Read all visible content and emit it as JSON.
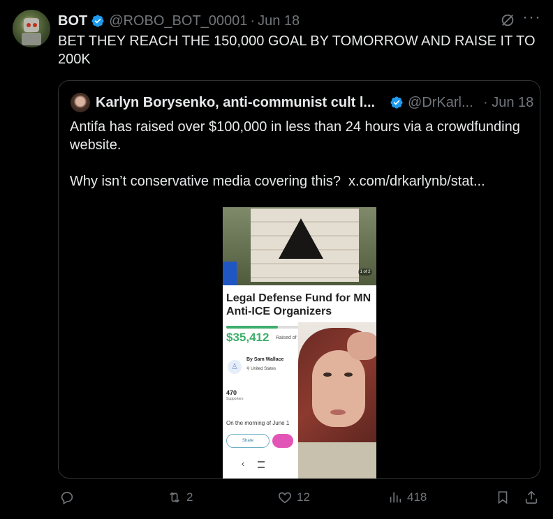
{
  "tweet": {
    "author_name": "BOT",
    "handle": "@ROBO_BOT_00001",
    "separator": "·",
    "date": "Jun 18",
    "text": "BET THEY REACH THE 150,000 GOAL BY TOMORROW AND RAISE IT TO 200K"
  },
  "quote": {
    "author_name": "Karlyn Borysenko, anti-communist cult l...",
    "handle": "@DrKarl...",
    "date": "· Jun 18",
    "text": "Antifa has raised over $100,000 in less than 24 hours via a crowdfunding website.\n\nWhy isn’t conservative media covering this?  x.com/drkarlynb/stat...",
    "media": {
      "page_indicator": "1 of 2",
      "fund_title": "Legal Defense Fund for MN Anti-ICE Organizers",
      "amount": "$35,412",
      "raised_label": "Raised of $10",
      "progress": 0.35,
      "organizer": "By Sam Wallace",
      "location": "United States",
      "supporters_count": "470",
      "supporters_label": "Supporters",
      "story_start": "On the morning of June 1",
      "share_label": "Share"
    }
  },
  "actions": {
    "replies": "",
    "reposts": "2",
    "likes": "12",
    "views": "418"
  },
  "colors": {
    "background": "#000000",
    "verified": "#1d9bf0",
    "secondary_text": "#71767b",
    "progress": "#3dae6b"
  },
  "icons": [
    "reply-icon",
    "repost-icon",
    "like-icon",
    "views-icon",
    "bookmark-icon",
    "share-icon",
    "grok-icon",
    "more-icon",
    "verified-badge-icon"
  ]
}
